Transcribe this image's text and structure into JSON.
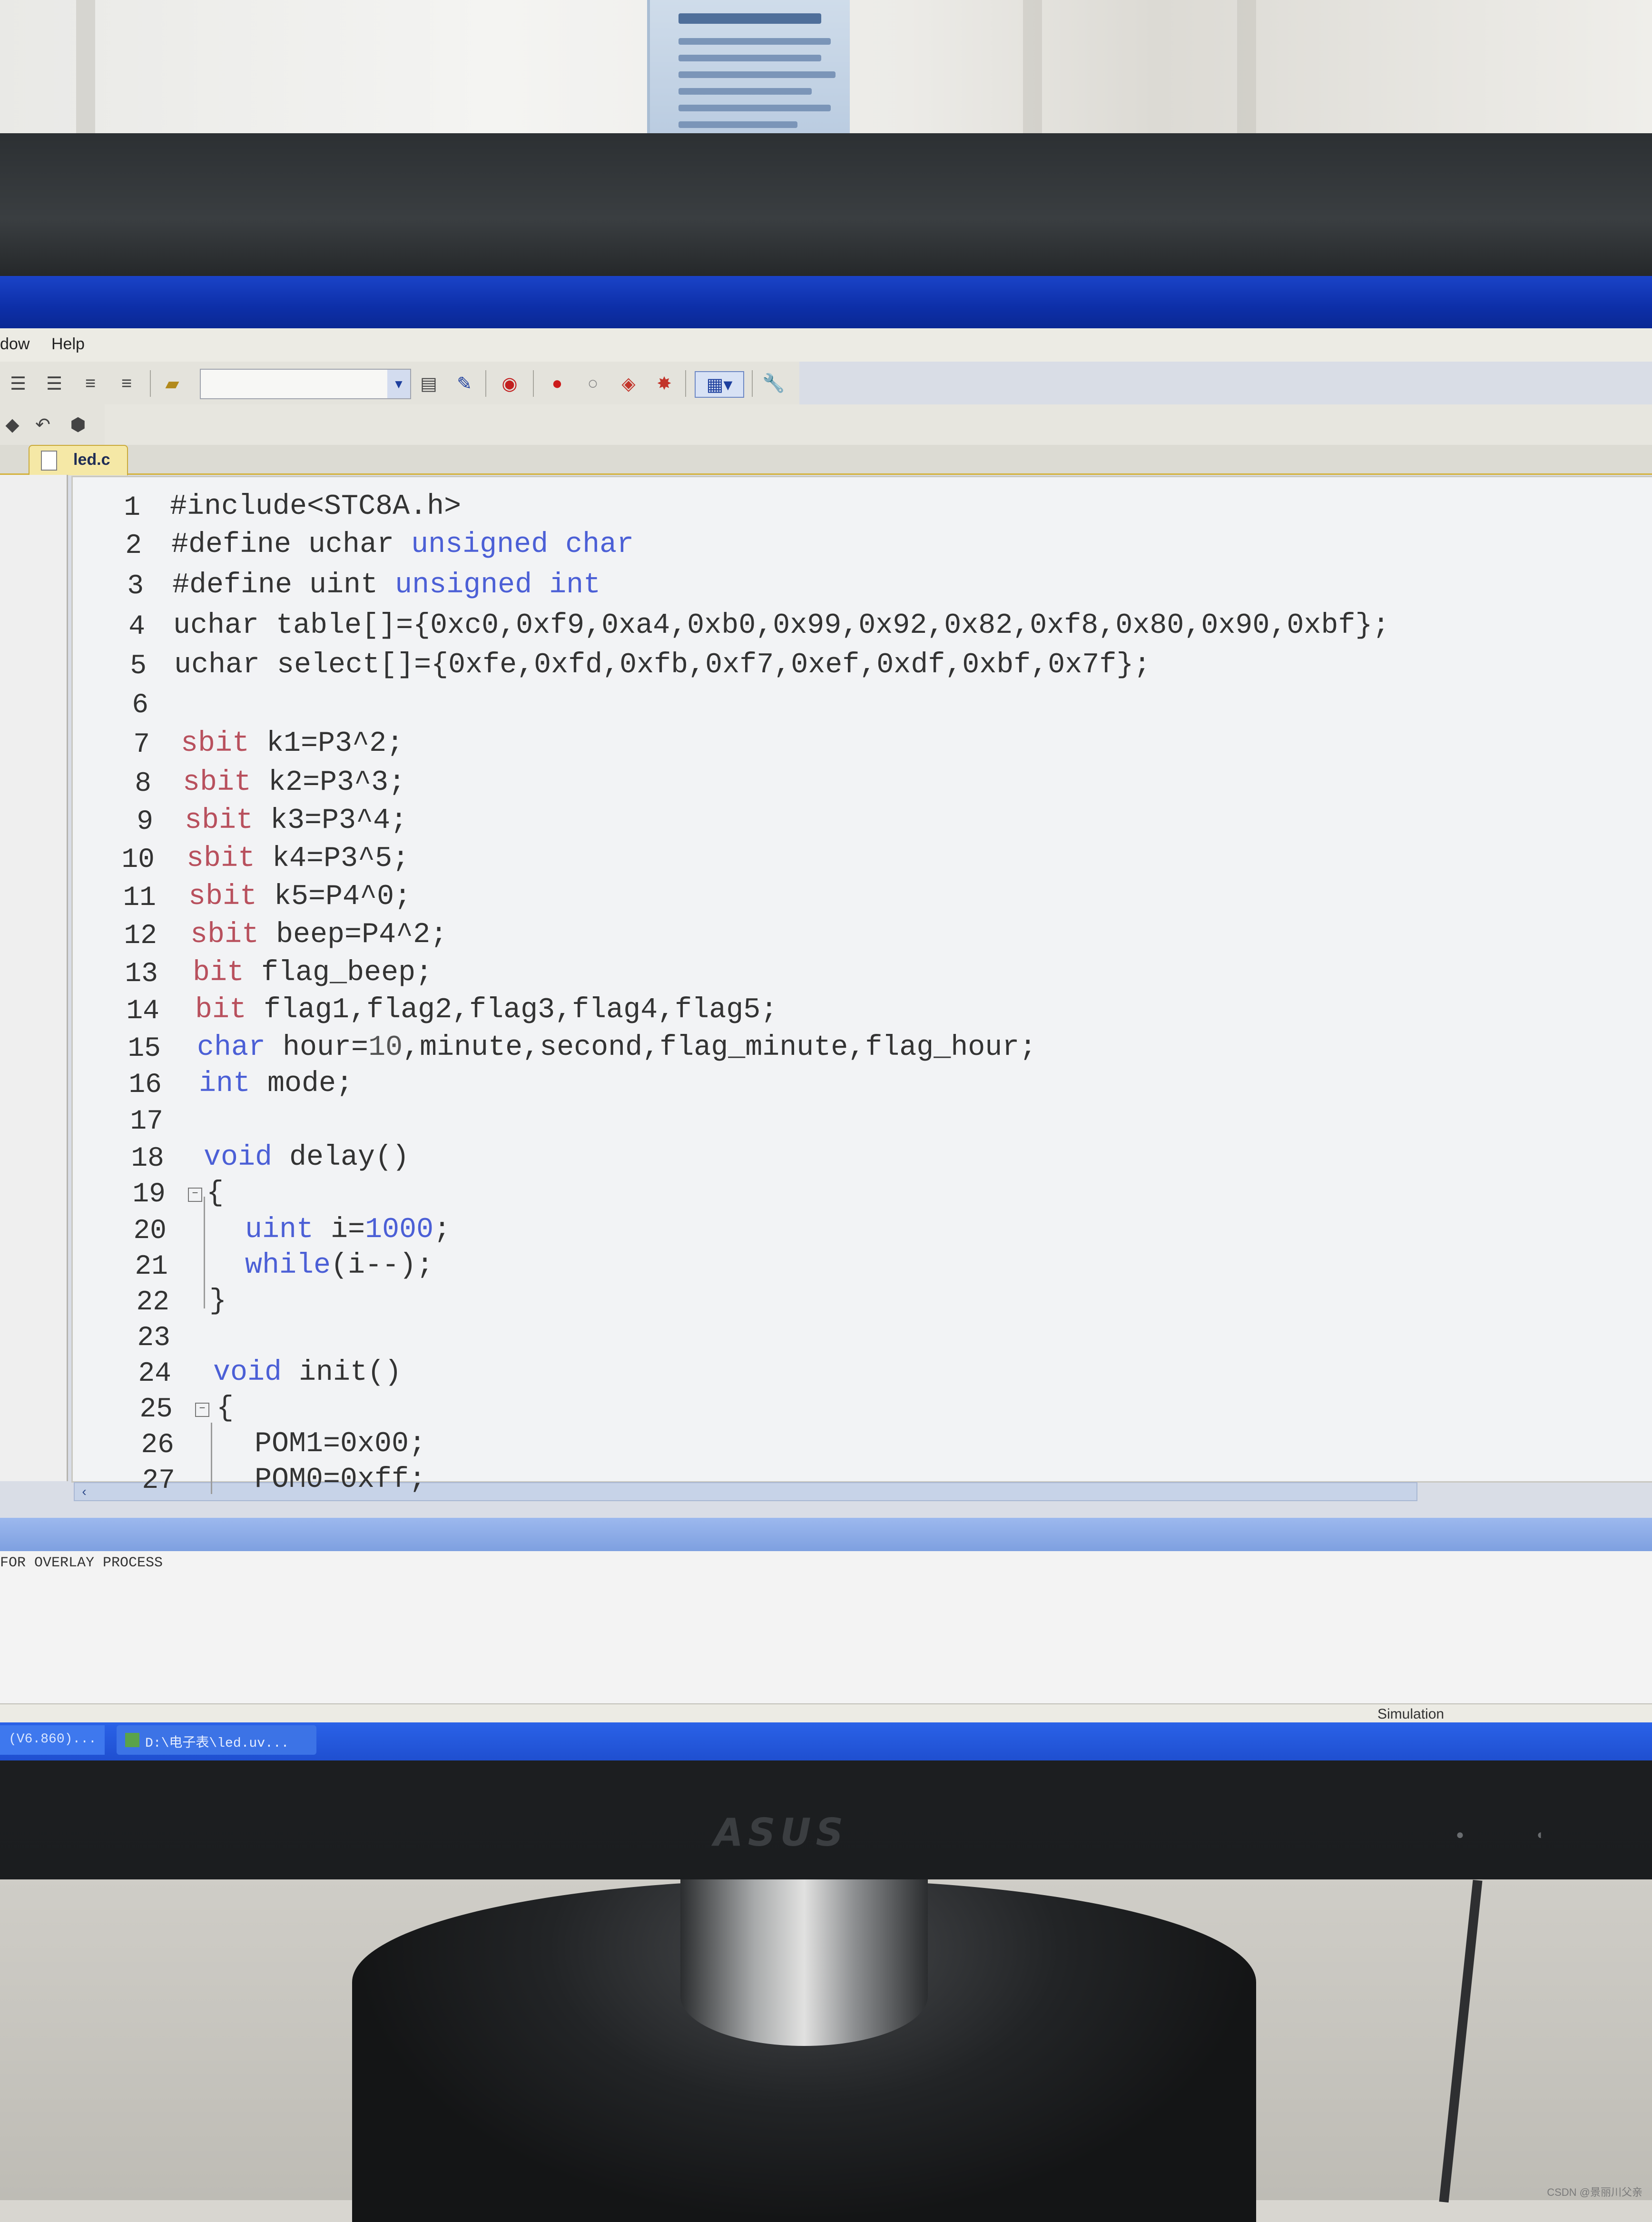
{
  "menu": {
    "window_partial": "dow",
    "help": "Help"
  },
  "editor": {
    "tab_label": "led.c",
    "lines": [
      {
        "n": "1",
        "code": "#include<STC8A.h>"
      },
      {
        "n": "2",
        "code": "#define uchar unsigned char"
      },
      {
        "n": "3",
        "code": "#define uint unsigned int"
      },
      {
        "n": "4",
        "code": "uchar table[]={0xc0,0xf9,0xa4,0xb0,0x99,0x92,0x82,0xf8,0x80,0x90,0xbf};"
      },
      {
        "n": "5",
        "code": "uchar select[]={0xfe,0xfd,0xfb,0xf7,0xef,0xdf,0xbf,0x7f};"
      },
      {
        "n": "6",
        "code": ""
      },
      {
        "n": "7",
        "code": "sbit k1=P3^2;"
      },
      {
        "n": "8",
        "code": "sbit k2=P3^3;"
      },
      {
        "n": "9",
        "code": "sbit k3=P3^4;"
      },
      {
        "n": "10",
        "code": "sbit k4=P3^5;"
      },
      {
        "n": "11",
        "code": "sbit k5=P4^0;"
      },
      {
        "n": "12",
        "code": "sbit beep=P4^2;"
      },
      {
        "n": "13",
        "code": "bit flag_beep;"
      },
      {
        "n": "14",
        "code": "bit flag1,flag2,flag3,flag4,flag5;"
      },
      {
        "n": "15",
        "code": "char hour=10,minute,second,flag_minute,flag_hour;"
      },
      {
        "n": "16",
        "code": "int mode;"
      },
      {
        "n": "17",
        "code": ""
      },
      {
        "n": "18",
        "code": "void delay()"
      },
      {
        "n": "19",
        "code": "{"
      },
      {
        "n": "20",
        "code": "uint i=1000;"
      },
      {
        "n": "21",
        "code": "while(i--);"
      },
      {
        "n": "22",
        "code": "}"
      },
      {
        "n": "23",
        "code": ""
      },
      {
        "n": "24",
        "code": "void init()"
      },
      {
        "n": "25",
        "code": "{"
      },
      {
        "n": "26",
        "code": "POM1=0x00;"
      },
      {
        "n": "27",
        "code": "POM0=0xff;"
      }
    ]
  },
  "output": {
    "text": "FOR OVERLAY PROCESS"
  },
  "status": {
    "mode": "Simulation"
  },
  "taskbar": {
    "left_label": "(V6.860)...",
    "task_label": "D:\\电子表\\led.uv..."
  },
  "monitor": {
    "brand": "ASUS"
  },
  "watermark": "CSDN @景丽川父亲",
  "colors": {
    "keyword": "#4b5fd6",
    "type_sbit": "#b8505d",
    "titlebar": "#1a43c8",
    "tab": "#f5e8a6"
  }
}
